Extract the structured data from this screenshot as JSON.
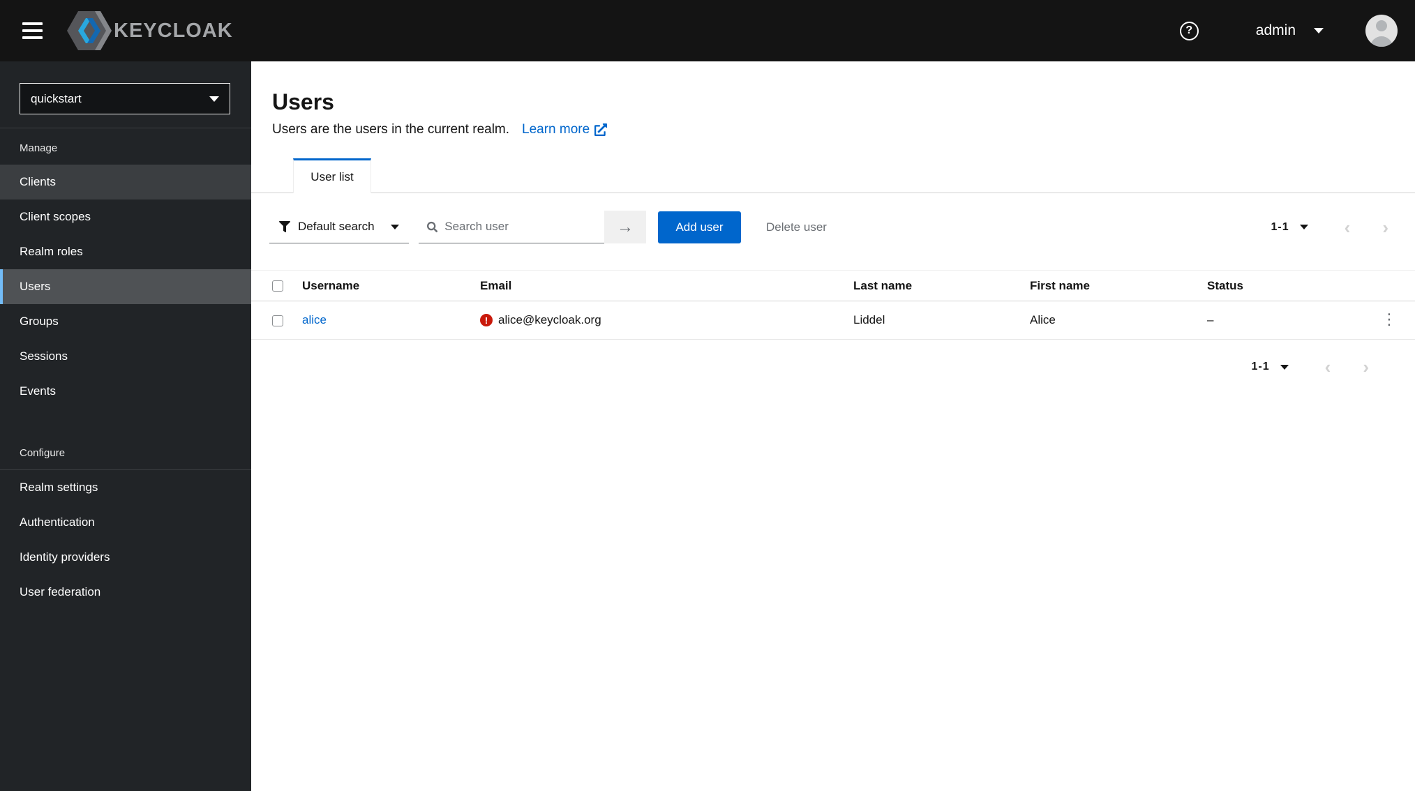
{
  "header": {
    "brand_text": "KEYCLOAK",
    "username": "admin"
  },
  "sidebar": {
    "realm": "quickstart",
    "manage_label": "Manage",
    "manage_items": [
      "Clients",
      "Client scopes",
      "Realm roles",
      "Users",
      "Groups",
      "Sessions",
      "Events"
    ],
    "configure_label": "Configure",
    "configure_items": [
      "Realm settings",
      "Authentication",
      "Identity providers",
      "User federation"
    ],
    "active_item": "Users"
  },
  "main": {
    "title": "Users",
    "description": "Users are the users in the current realm.",
    "learn_more_label": "Learn more",
    "tab_user_list": "User list",
    "toolbar": {
      "filter_selected": "Default search",
      "search_placeholder": "Search user",
      "add_user": "Add user",
      "delete_user": "Delete user",
      "pagination_range": "1-1"
    },
    "table": {
      "columns": [
        "Username",
        "Email",
        "Last name",
        "First name",
        "Status"
      ],
      "rows": [
        {
          "username": "alice",
          "email": "alice@keycloak.org",
          "email_invalid": true,
          "last_name": "Liddel",
          "first_name": "Alice",
          "status": "–"
        }
      ]
    },
    "pagination_bottom_range": "1-1"
  },
  "glyphs": {
    "question": "?",
    "exclamation": "!",
    "arrow_right": "→",
    "chevron_left": "‹",
    "chevron_right": "›",
    "kebab": "⋮"
  },
  "colors": {
    "accent_blue": "#0066cc",
    "danger_red": "#c9190b",
    "nav_active_indicator": "#73bcf7",
    "masthead_bg": "#141414",
    "sidebar_bg": "#212427"
  }
}
